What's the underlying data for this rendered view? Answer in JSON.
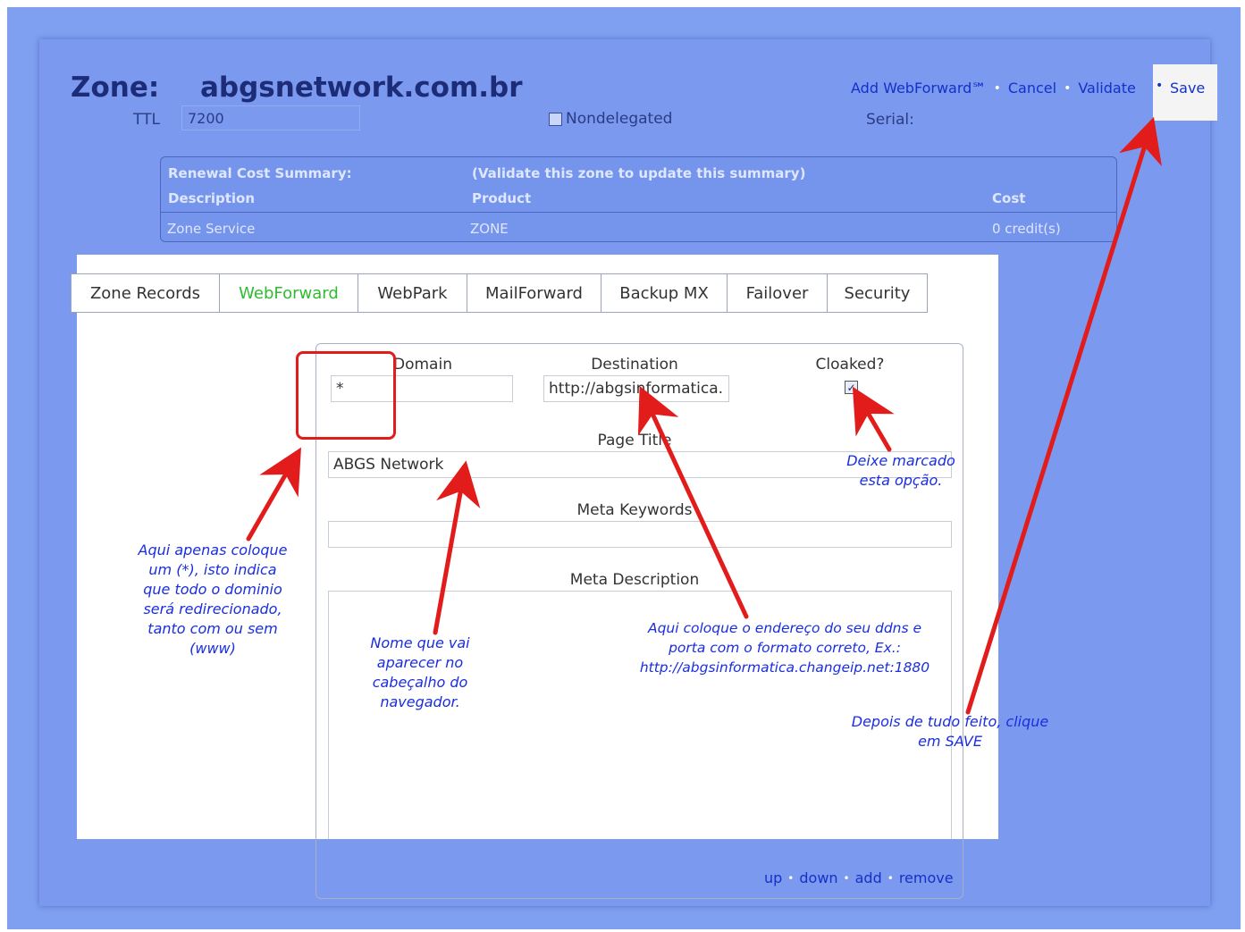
{
  "header": {
    "zone_label": "Zone:",
    "zone_name": "abgsnetwork.com.br",
    "ttl_label": "TTL",
    "ttl_value": "7200",
    "nondelegated_label": "Nondelegated",
    "serial_label": "Serial:",
    "links": {
      "add_webforward": "Add WebForward℠",
      "cancel": "Cancel",
      "validate": "Validate",
      "save": "Save"
    },
    "separator": "•"
  },
  "cost_summary": {
    "title": "Renewal Cost Summary:",
    "note": "(Validate this zone to update this summary)",
    "col_description": "Description",
    "col_product": "Product",
    "col_cost": "Cost",
    "rows": [
      {
        "description": "Zone Service",
        "product": "ZONE",
        "cost": "0 credit(s)"
      }
    ]
  },
  "tabs": [
    {
      "label": "Zone Records",
      "active": false
    },
    {
      "label": "WebForward",
      "active": true
    },
    {
      "label": "WebPark",
      "active": false
    },
    {
      "label": "MailForward",
      "active": false
    },
    {
      "label": "Backup MX",
      "active": false
    },
    {
      "label": "Failover",
      "active": false
    },
    {
      "label": "Security",
      "active": false
    }
  ],
  "form": {
    "sub_domain_label": "Domain",
    "sub_domain_value": "*",
    "destination_label": "Destination",
    "destination_value": "http://abgsinformatica.ch",
    "cloaked_label": "Cloaked?",
    "cloaked_checked": true,
    "page_title_label": "Page Title",
    "page_title_value": "ABGS Network",
    "meta_keywords_label": "Meta Keywords",
    "meta_keywords_value": "",
    "meta_description_label": "Meta Description",
    "meta_description_value": ""
  },
  "row_actions": {
    "up": "up",
    "down": "down",
    "add": "add",
    "remove": "remove"
  },
  "annotations": {
    "sub_domain_note": [
      "Aqui apenas coloque",
      "um (*), isto indica",
      "que todo o dominio",
      "será redirecionado,",
      "tanto com ou sem",
      "(www)"
    ],
    "page_title_note": [
      "Nome que vai",
      "aparecer no",
      "cabeçalho do",
      "navegador."
    ],
    "destination_note": [
      "Aqui coloque o endereço do seu ddns e",
      "porta com o formato correto, Ex.:",
      "http://abgsinformatica.changeip.net:1880"
    ],
    "cloaked_note": [
      "Deixe marcado",
      "esta opção."
    ],
    "save_note": [
      "Depois de tudo feito, clique",
      "em SAVE"
    ],
    "arrow_color": "#e21b1b",
    "note_color": "#1a2ee0"
  },
  "colors": {
    "page_blue": "#7b9aef",
    "title_navy": "#1c2c78",
    "link_blue": "#1530c8",
    "active_tab_green": "#2fbb2f"
  }
}
